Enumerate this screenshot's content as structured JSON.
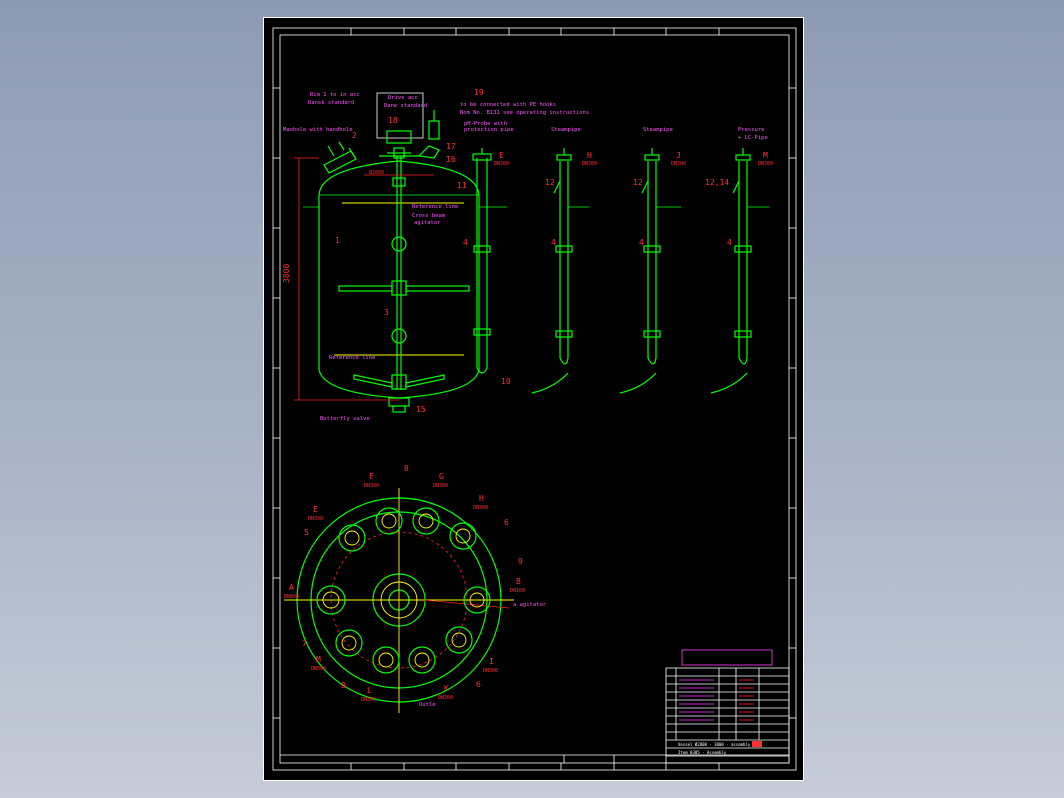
{
  "labels": {
    "manhole": "Manhole with handhole",
    "rim_top": "Rim 1 to in acc",
    "rim_bottom": "Dansk standard",
    "drive_top": "Drive acc",
    "drive_bottom": "Dane standard",
    "note1": "to be connected with PE hooks",
    "note2": "Nom No. B131 see operating instructions",
    "ph_probe": "pH-Probe with",
    "protection_pipe": "protection pipe",
    "reference_line_top": "Reference line",
    "cross_beam": "Cross beam",
    "agitator": "agitator",
    "reference_line_bottom": "Reference line",
    "butterfly_valve": "Butterfly valve",
    "steampipe_h": "Steampipe",
    "steampipe_j": "Steampipe",
    "pressure_1": "Pressure",
    "pressure_2": "+ LC-Pipe",
    "agitator_plan": "a agitator",
    "outlet": "Outle",
    "height_dim": "3800",
    "diameter_dim": "Ø2800",
    "dn_100": "DN100",
    "dn_300": "DN300",
    "dn_800": "DN800",
    "pos_1": "1",
    "pos_2": "2",
    "pos_3": "3",
    "pos_4": "4",
    "pos_5": "5",
    "pos_6": "6",
    "pos_7": "7",
    "pos_8": "8",
    "pos_9": "9",
    "pos_10": "10",
    "pos_11": "11",
    "pos_12": "12",
    "pos_1214": "12,14",
    "pos_15": "15",
    "pos_16": "16",
    "pos_17": "17",
    "pos_18": "18",
    "pos_19": "19",
    "letter_a": "A",
    "letter_b": "B",
    "letter_e": "E",
    "letter_f": "F",
    "letter_g": "G",
    "letter_h": "H",
    "letter_i": "I",
    "letter_j": "J",
    "letter_k": "K",
    "letter_l": "L",
    "letter_m": "M"
  },
  "title_block": {
    "line1": "Vessel Ø2800 · 3800 · assembly",
    "line2": "Item 8385 · Assembly"
  }
}
